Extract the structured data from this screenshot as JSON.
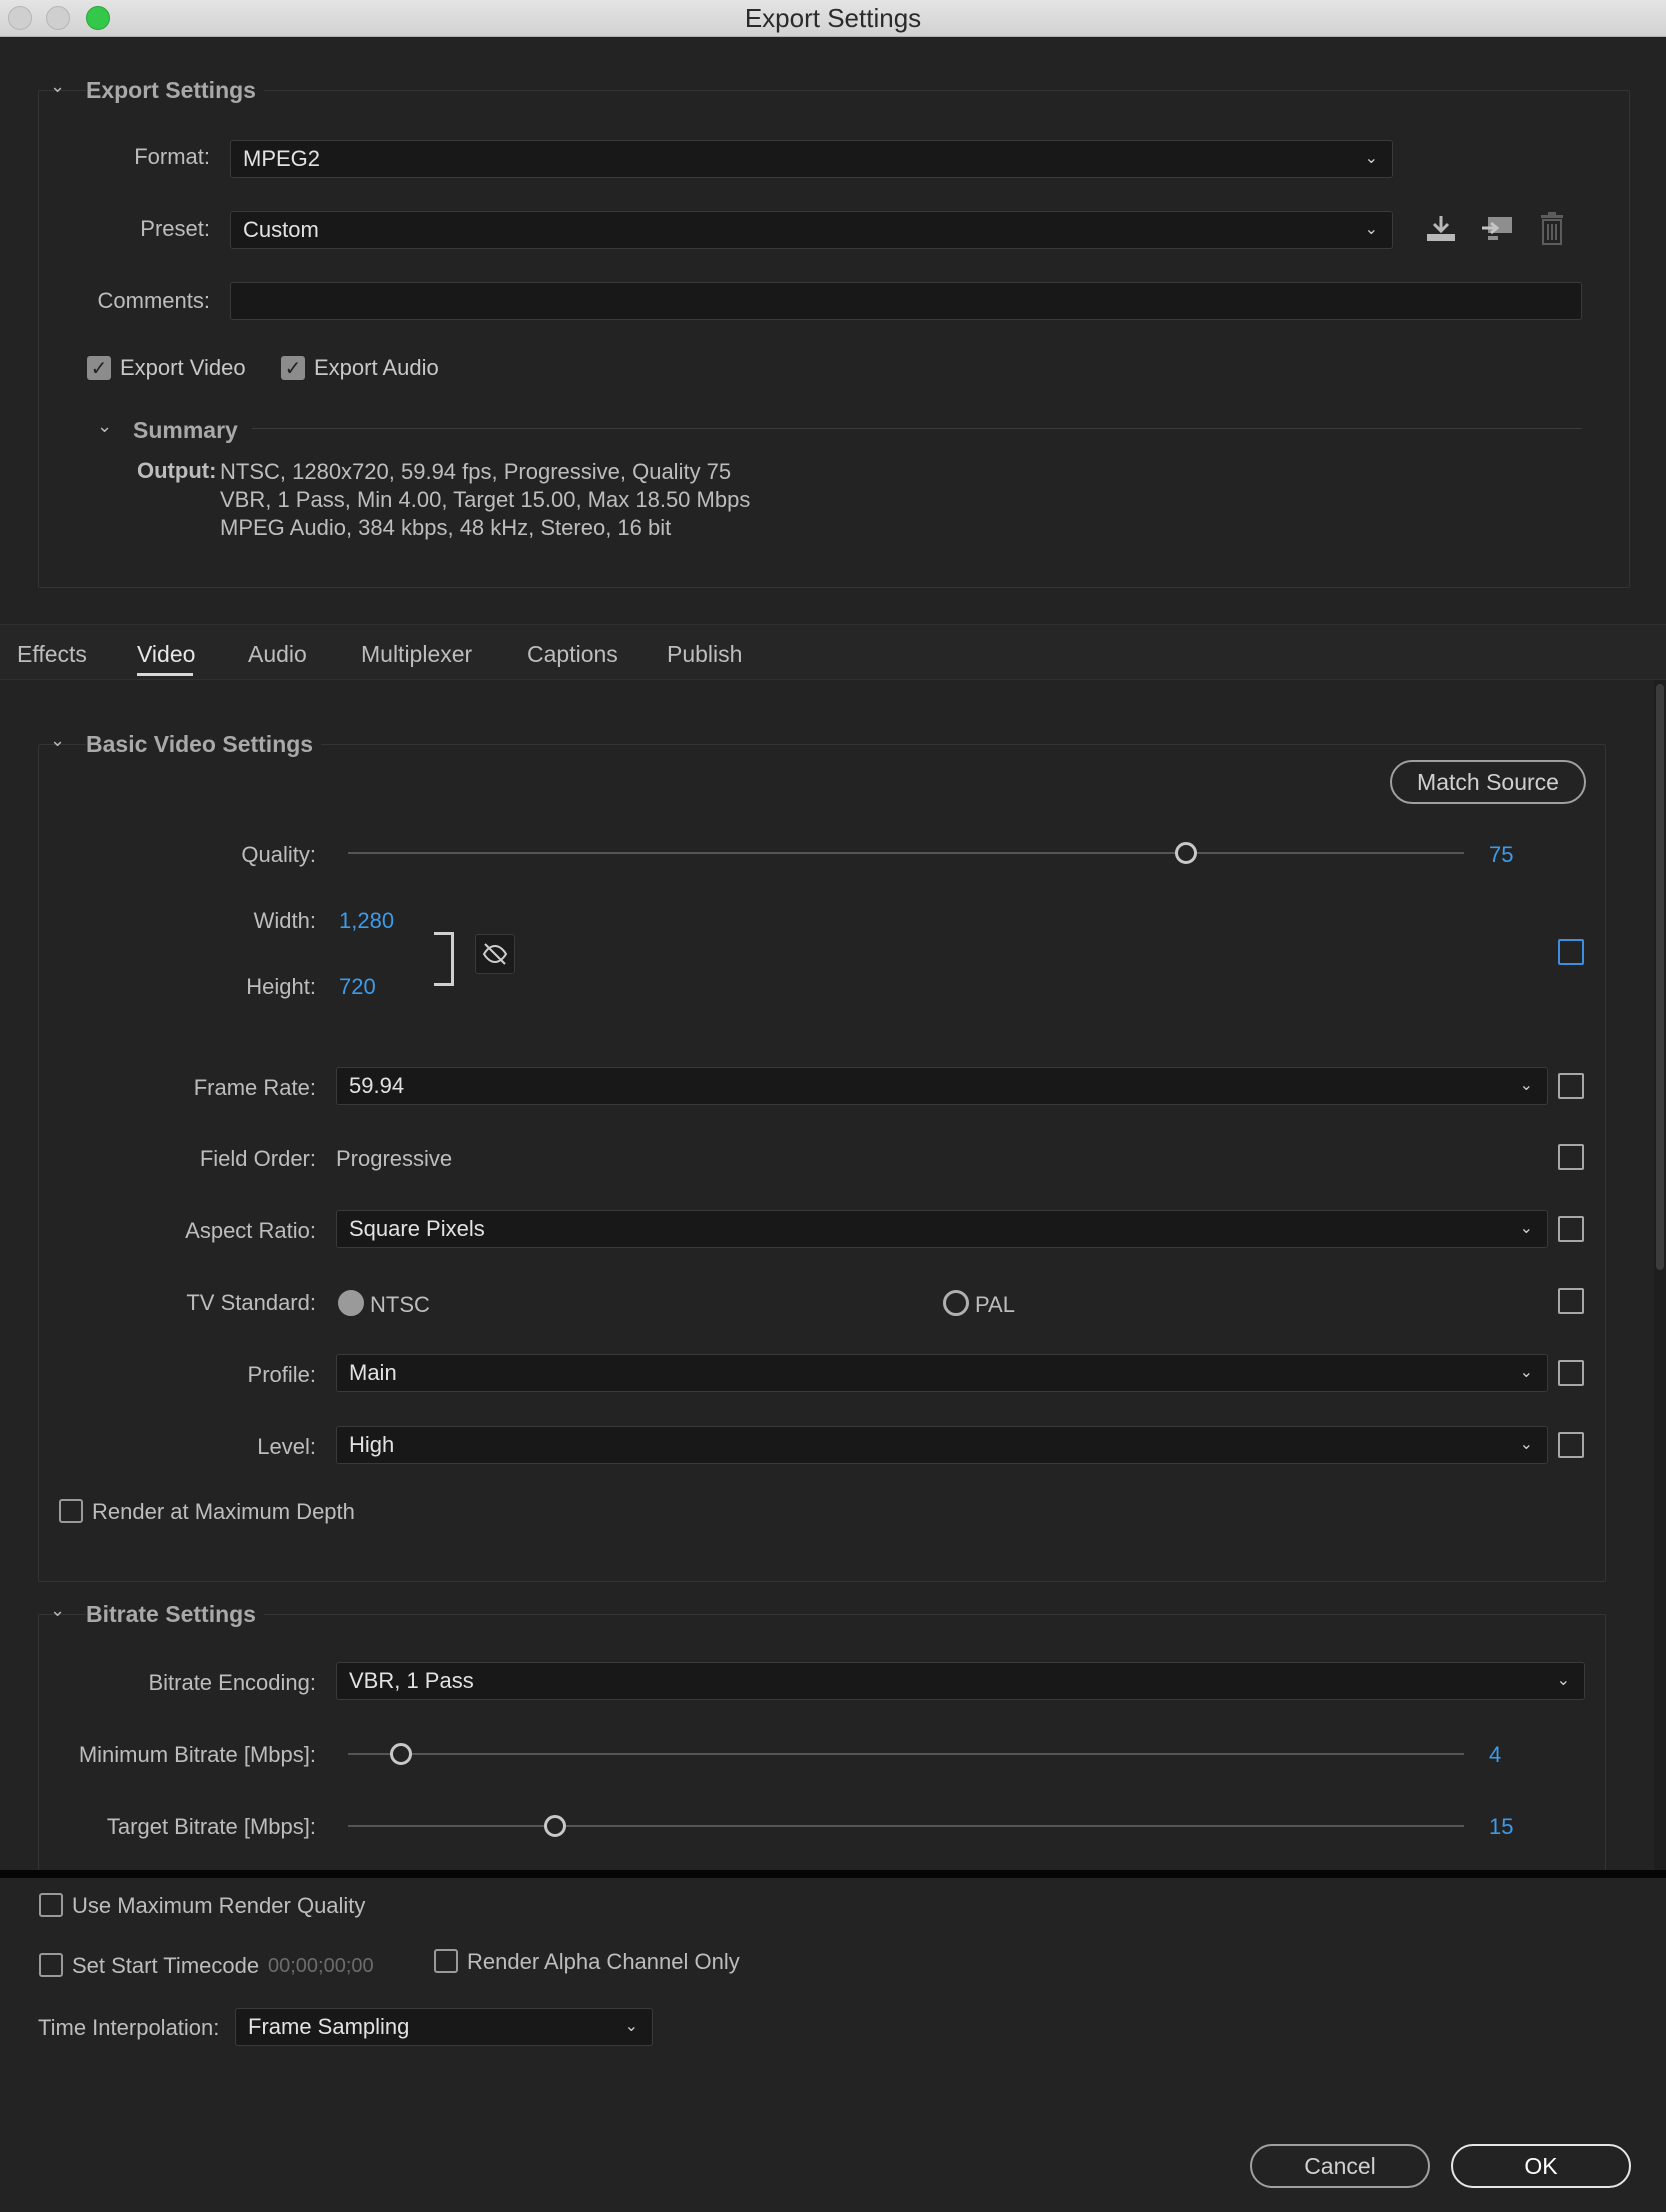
{
  "window": {
    "title": "Export Settings"
  },
  "export_settings": {
    "section_title": "Export Settings",
    "format_label": "Format:",
    "format_value": "MPEG2",
    "preset_label": "Preset:",
    "preset_value": "Custom",
    "comments_label": "Comments:",
    "comments_value": "",
    "export_video_label": "Export Video",
    "export_video_checked": true,
    "export_audio_label": "Export Audio",
    "export_audio_checked": true,
    "summary_title": "Summary",
    "output_label": "Output:",
    "output_lines": [
      "NTSC, 1280x720, 59.94 fps, Progressive, Quality 75",
      "VBR, 1 Pass, Min 4.00, Target 15.00, Max 18.50 Mbps",
      "MPEG Audio, 384 kbps, 48 kHz, Stereo, 16 bit"
    ]
  },
  "tabs": [
    {
      "label": "Effects",
      "active": false
    },
    {
      "label": "Video",
      "active": true
    },
    {
      "label": "Audio",
      "active": false
    },
    {
      "label": "Multiplexer",
      "active": false
    },
    {
      "label": "Captions",
      "active": false
    },
    {
      "label": "Publish",
      "active": false
    }
  ],
  "basic_video": {
    "section_title": "Basic Video Settings",
    "match_source": "Match Source",
    "quality_label": "Quality:",
    "quality_value": "75",
    "quality_fraction": 0.75,
    "width_label": "Width:",
    "width_value": "1,280",
    "height_label": "Height:",
    "height_value": "720",
    "frame_rate_label": "Frame Rate:",
    "frame_rate_value": "59.94",
    "field_order_label": "Field Order:",
    "field_order_value": "Progressive",
    "aspect_ratio_label": "Aspect Ratio:",
    "aspect_ratio_value": "Square Pixels",
    "tv_standard_label": "TV Standard:",
    "tv_ntsc": "NTSC",
    "tv_pal": "PAL",
    "tv_selected": "NTSC",
    "profile_label": "Profile:",
    "profile_value": "Main",
    "level_label": "Level:",
    "level_value": "High",
    "render_max_depth": "Render at Maximum Depth"
  },
  "bitrate": {
    "section_title": "Bitrate Settings",
    "encoding_label": "Bitrate Encoding:",
    "encoding_value": "VBR, 1 Pass",
    "min_label": "Minimum Bitrate [Mbps]:",
    "min_value": "4",
    "target_label": "Target Bitrate [Mbps]:",
    "target_value": "15"
  },
  "bottom": {
    "max_render_quality": "Use Maximum Render Quality",
    "set_start_timecode": "Set Start Timecode",
    "timecode_value": "00;00;00;00",
    "render_alpha": "Render Alpha Channel Only",
    "time_interp_label": "Time Interpolation:",
    "time_interp_value": "Frame Sampling",
    "cancel": "Cancel",
    "ok": "OK"
  },
  "icons": [
    "chevron-down-icon",
    "save-preset-icon",
    "import-preset-icon",
    "trash-icon",
    "unlink-icon"
  ]
}
